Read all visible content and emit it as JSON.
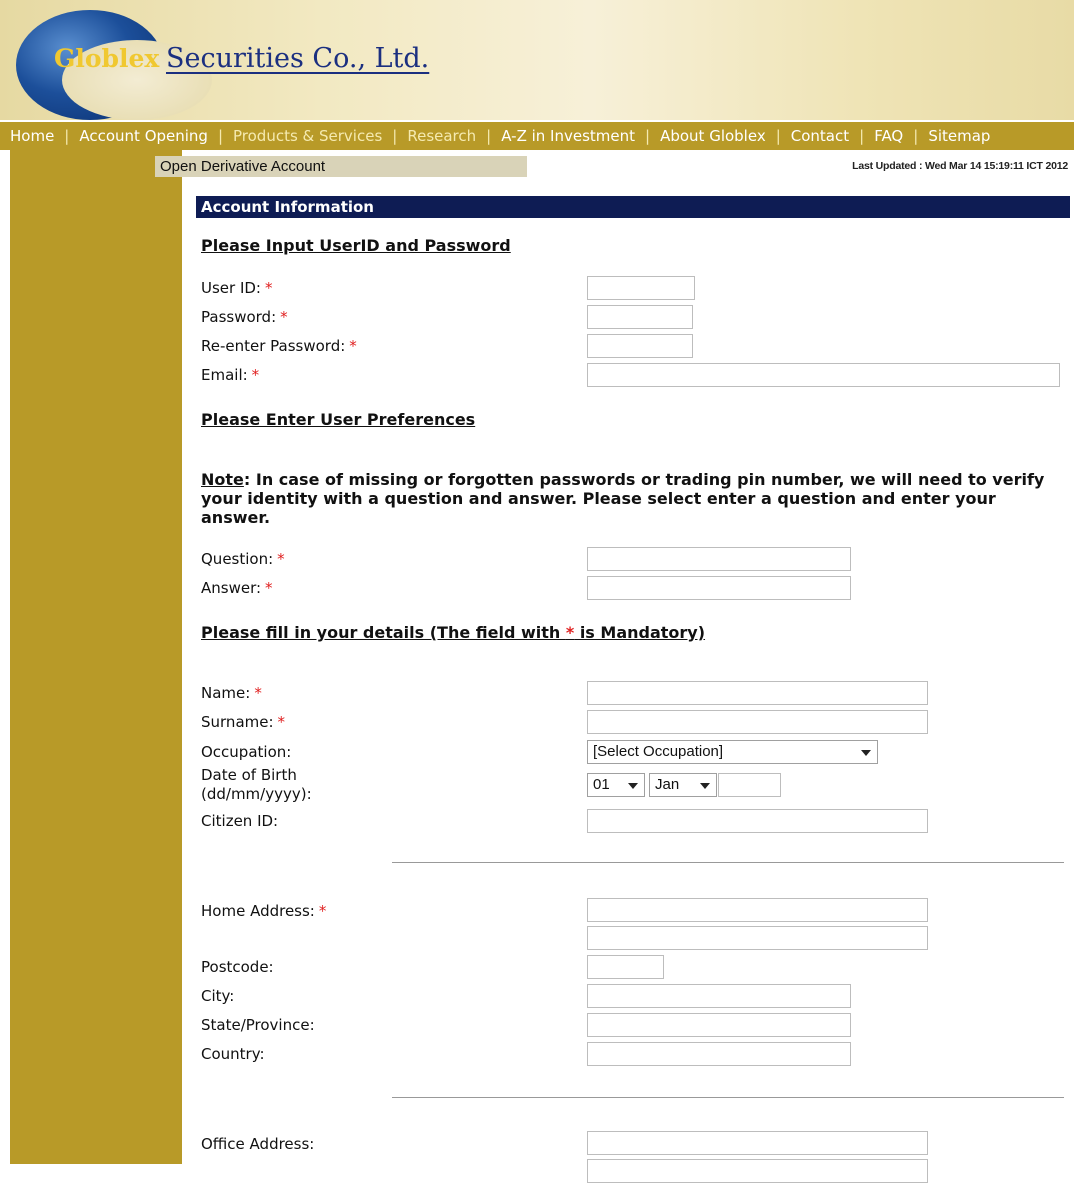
{
  "header": {
    "logo_word1": "Globlex",
    "logo_word2": "Securities Co., Ltd."
  },
  "nav": [
    {
      "label": "Home",
      "style": "normal"
    },
    {
      "label": "Account Opening",
      "style": "normal"
    },
    {
      "label": "Products & Services",
      "style": "alt"
    },
    {
      "label": "Research",
      "style": "alt"
    },
    {
      "label": "A-Z in Investment",
      "style": "normal"
    },
    {
      "label": "About Globlex",
      "style": "normal"
    },
    {
      "label": "Contact",
      "style": "normal"
    },
    {
      "label": "FAQ",
      "style": "normal"
    },
    {
      "label": "Sitemap",
      "style": "normal"
    }
  ],
  "subbar": {
    "title": "Open Derivative Account"
  },
  "last_updated": "Last Updated : Wed Mar 14 15:19:11 ICT 2012",
  "section": {
    "title": "Account Information"
  },
  "headings": {
    "userid": "Please Input UserID and Password",
    "prefs": "Please Enter User Preferences",
    "details_pre": "Please fill in your details (The field with ",
    "details_star": "*",
    "details_post": " is Mandatory)"
  },
  "note": {
    "prefix": "Note",
    "text": ": In case of missing or forgotten passwords or trading pin number, we will need to verify your identity with a question and answer. Please select enter a question and enter your answer."
  },
  "required_mark": "*",
  "labels": {
    "user_id": "User ID:",
    "password": "Password:",
    "reenter_password": "Re-enter Password:",
    "email": "Email:",
    "question": "Question:",
    "answer": "Answer:",
    "name": "Name:",
    "surname": "Surname:",
    "occupation": "Occupation:",
    "dob_line1": "Date of Birth",
    "dob_line2": "(dd/mm/yyyy):",
    "citizen_id": "Citizen ID:",
    "home_address": "Home Address:",
    "postcode": "Postcode:",
    "city": "City:",
    "state": "State/Province:",
    "country": "Country:",
    "office_address": "Office Address:"
  },
  "selects": {
    "occupation": "[Select Occupation]",
    "dob_day": "01",
    "dob_month": "Jan"
  },
  "colors": {
    "gold": "#b89a28",
    "navy": "#0e1c54",
    "required": "#e02020"
  }
}
